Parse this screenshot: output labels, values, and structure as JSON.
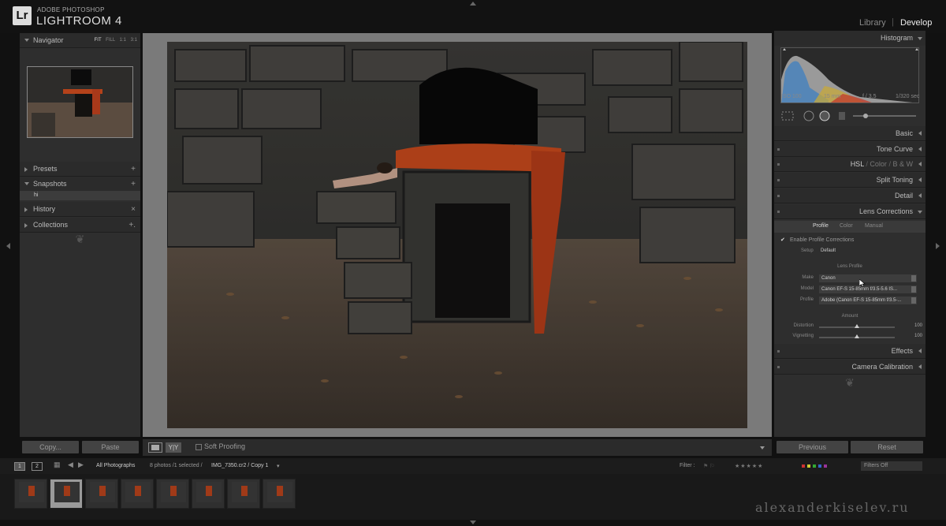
{
  "app": {
    "brand_sub": "ADOBE PHOTOSHOP",
    "brand_name": "LIGHTROOM 4",
    "badge": "Lr",
    "modules": [
      {
        "label": "Library",
        "active": false
      },
      {
        "label": "Develop",
        "active": true
      }
    ],
    "module_separator": "|"
  },
  "left_panel": {
    "navigator": {
      "label": "Navigator",
      "options": [
        "FIT",
        "FILL",
        "1:1",
        "3:1"
      ],
      "active_option": "FIT"
    },
    "presets": {
      "label": "Presets",
      "action": "+"
    },
    "snapshots": {
      "label": "Snapshots",
      "action": "+",
      "items": [
        "hi"
      ]
    },
    "history": {
      "label": "History",
      "action": "×"
    },
    "collections": {
      "label": "Collections",
      "action": "+."
    },
    "ornament": "❦",
    "copy_button": "Copy...",
    "paste_button": "Paste"
  },
  "toolbar": {
    "view_yy": "Y|Y",
    "soft_proofing_label": "Soft Proofing",
    "soft_proofing_checked": false
  },
  "right_panel": {
    "histogram": {
      "label": "Histogram",
      "iso": "ISO 100",
      "focal": "15 mm",
      "aperture": "f / 3.5",
      "shutter": "1/320 sec"
    },
    "sections": [
      {
        "label": "Basic",
        "expanded": false
      },
      {
        "label": "Tone Curve",
        "expanded": false
      },
      {
        "label": "Split Toning",
        "expanded": false
      },
      {
        "label": "Detail",
        "expanded": false
      },
      {
        "label": "Lens Corrections",
        "expanded": true
      },
      {
        "label": "Effects",
        "expanded": false
      },
      {
        "label": "Camera Calibration",
        "expanded": false
      }
    ],
    "hsl": {
      "hsl": "HSL",
      "sep": "/",
      "color": "Color",
      "bw": "B & W"
    },
    "lens": {
      "tabs": [
        {
          "label": "Profile",
          "active": true
        },
        {
          "label": "Color",
          "active": false
        },
        {
          "label": "Manual",
          "active": false
        }
      ],
      "enable_label": "Enable Profile Corrections",
      "enable_checked": true,
      "setup_label": "Setup",
      "setup_value": "Default",
      "lens_profile_label": "Lens Profile",
      "make_label": "Make",
      "make_value": "Canon",
      "model_label": "Model",
      "model_value": "Canon EF-S 15-85mm f/3.5-5.6 IS...",
      "profile_label": "Profile",
      "profile_value": "Adobe (Canon EF-S 15-85mm f/3.5-...",
      "amount_label": "Amount",
      "distortion_label": "Distortion",
      "distortion_value": "100",
      "distortion_level": 0.5,
      "vignetting_label": "Vignetting",
      "vignetting_value": "100",
      "vignetting_level": 0.5
    },
    "ornament": "❦",
    "previous_button": "Previous",
    "reset_button": "Reset"
  },
  "filmstrip_bar": {
    "screen1": "1",
    "screen2": "2",
    "source": "All Photographs",
    "status": "8 photos /1 selected /",
    "filename": "IMG_7350.cr2 / Copy 1",
    "filter_label": "Filter :",
    "filters_off": "Filters Off"
  },
  "filmstrip": {
    "thumbnails": [
      {
        "selected": false
      },
      {
        "selected": true
      },
      {
        "selected": false
      },
      {
        "selected": false
      },
      {
        "selected": false
      },
      {
        "selected": false
      },
      {
        "selected": false
      },
      {
        "selected": false
      }
    ]
  },
  "watermark": "alexanderkiselev.ru",
  "colors": {
    "accent_red": "#c5481b",
    "panel": "#2e2e2e",
    "background": "#111111"
  }
}
